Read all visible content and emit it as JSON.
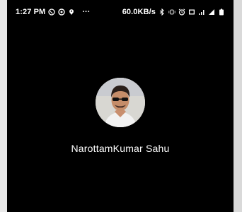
{
  "status_bar": {
    "time": "1:27 PM",
    "more": "···",
    "network_speed": "60.0KB/s",
    "icons_left": [
      "whatsapp-icon",
      "instagram-icon",
      "location-icon"
    ],
    "icons_right": [
      "bluetooth-icon",
      "vibrate-icon",
      "alarm-icon",
      "screen-mirror-icon",
      "signal-icon",
      "signal-icon",
      "battery-icon"
    ]
  },
  "contact": {
    "name": "NarottamKumar Sahu"
  },
  "colors": {
    "background": "#000000",
    "text": "#ffffff",
    "page_bg": "#e9e9e9"
  }
}
